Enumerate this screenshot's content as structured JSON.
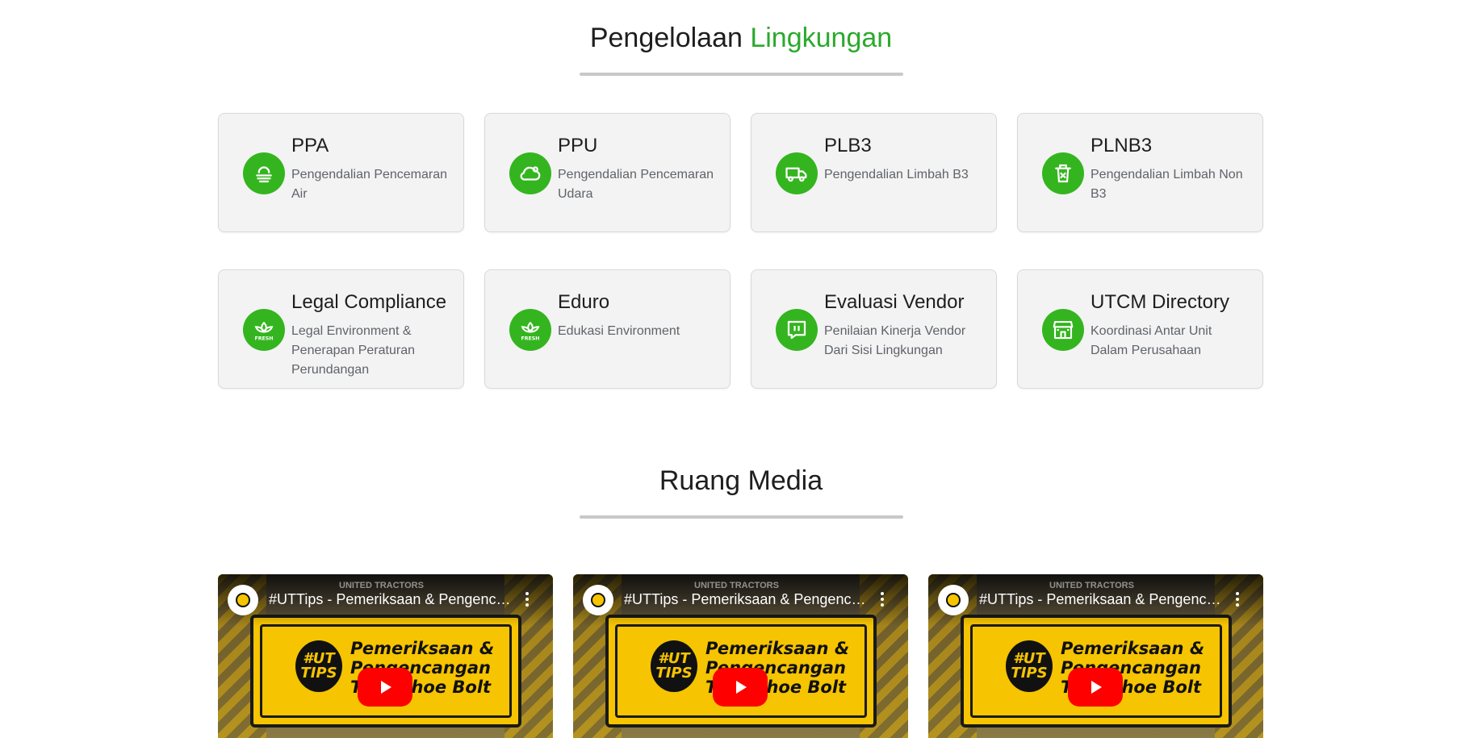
{
  "sections": {
    "environment": {
      "title_prefix": "Pengelolaan",
      "title_accent": "Lingkungan"
    },
    "media": {
      "title": "Ruang Media"
    }
  },
  "colors": {
    "accent": "#2ca92c",
    "icon_bg": "#34b51f",
    "play_button": "#ff0000"
  },
  "cards": [
    {
      "title": "PPA",
      "desc": "Pengendalian Pencemaran Air",
      "icon": "water-cloud-icon"
    },
    {
      "title": "PPU",
      "desc": "Pengendalian Pencemaran Udara",
      "icon": "cloud-icon"
    },
    {
      "title": "PLB3",
      "desc": "Pengendalian Limbah B3",
      "icon": "truck-icon"
    },
    {
      "title": "PLNB3",
      "desc": "Pengendalian Limbah Non B3",
      "icon": "trash-icon"
    },
    {
      "title": "Legal Compliance",
      "desc": "Legal Environment & Penerapan Peraturan Perundangan",
      "icon": "fresh-leaf-icon"
    },
    {
      "title": "Eduro",
      "desc": "Edukasi Environment",
      "icon": "fresh-leaf-icon"
    },
    {
      "title": "Evaluasi Vendor",
      "desc": "Penilaian Kinerja Vendor Dari Sisi Lingkungan",
      "icon": "chat-box-icon"
    },
    {
      "title": "UTCM Directory",
      "desc": "Koordinasi Antar Unit Dalam Perusahaan",
      "icon": "store-icon"
    }
  ],
  "videos": [
    {
      "title": "#UTTips - Pemeriksaan & Pengencangan Trackshoe Bolt",
      "brand": "UNITED TRACTORS",
      "badge": "#UT TIPS",
      "sign_text": "Pemeriksaan & Pengencangan Trackshoe Bolt"
    },
    {
      "title": "#UTTips - Pemeriksaan & Pengencangan Trackshoe Bolt",
      "brand": "UNITED TRACTORS",
      "badge": "#UT TIPS",
      "sign_text": "Pemeriksaan & Pengencangan Trackshoe Bolt"
    },
    {
      "title": "#UTTips - Pemeriksaan & Pengencangan Trackshoe Bolt",
      "brand": "UNITED TRACTORS",
      "badge": "#UT TIPS",
      "sign_text": "Pemeriksaan & Pengencangan Trackshoe Bolt"
    }
  ]
}
